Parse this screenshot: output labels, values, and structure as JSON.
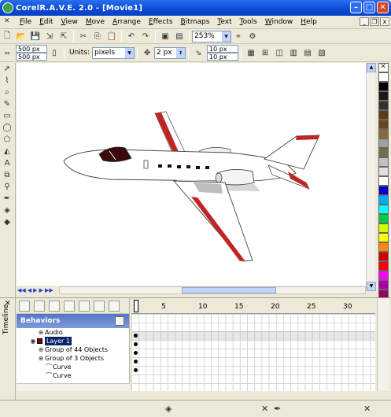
{
  "window": {
    "title": "CorelR.A.V.E. 2.0 - [Movie1]",
    "buttons": [
      "minimize-icon",
      "maximize-icon",
      "close-icon"
    ]
  },
  "menu": [
    "File",
    "Edit",
    "View",
    "Move",
    "Arrange",
    "Effects",
    "Bitmaps",
    "Text",
    "Tools",
    "Window",
    "Help"
  ],
  "toolbar1": {
    "zoom": "253%"
  },
  "toolbar2": {
    "width": "500 px",
    "height": "500 px",
    "units_label": "Units:",
    "units_value": "pixels",
    "nudge": "2 px",
    "dup_x": "10 px",
    "dup_y": "10 px"
  },
  "palette": [
    "#ffffff",
    "#000000",
    "#1a1a1a",
    "#303030",
    "#5a3a18",
    "#6b4423",
    "#8b6a3a",
    "#a0a0a0",
    "#707050",
    "#c0c0c0",
    "#e0e0e0",
    "#ffffff",
    "#0000cc",
    "#00aaff",
    "#00ffff",
    "#00cc44",
    "#ccff00",
    "#ffff00",
    "#ff8800",
    "#cc0000",
    "#ff0000",
    "#ff00ff",
    "#aa00aa",
    "#990066"
  ],
  "playback": [
    "rewind-icon",
    "prev-frame-icon",
    "play-icon",
    "next-frame-icon",
    "end-icon"
  ],
  "timeline": {
    "tab_label": "Timeline",
    "panel_title": "Behaviors",
    "tree": [
      {
        "label": "Audio",
        "indent": 2
      },
      {
        "label": "Layer 1",
        "indent": 1,
        "selected": true
      },
      {
        "label": "Group of 44 Objects",
        "indent": 2
      },
      {
        "label": "Group of 3 Objects",
        "indent": 2
      },
      {
        "label": "Curve",
        "indent": 3
      },
      {
        "label": "Curve",
        "indent": 3
      }
    ],
    "frame_ticks": [
      "1",
      "5",
      "10",
      "15",
      "20",
      "25",
      "30"
    ]
  },
  "statusbar": {
    "icons": [
      "fill-icon",
      "stroke-none-icon",
      "pen-icon"
    ]
  }
}
